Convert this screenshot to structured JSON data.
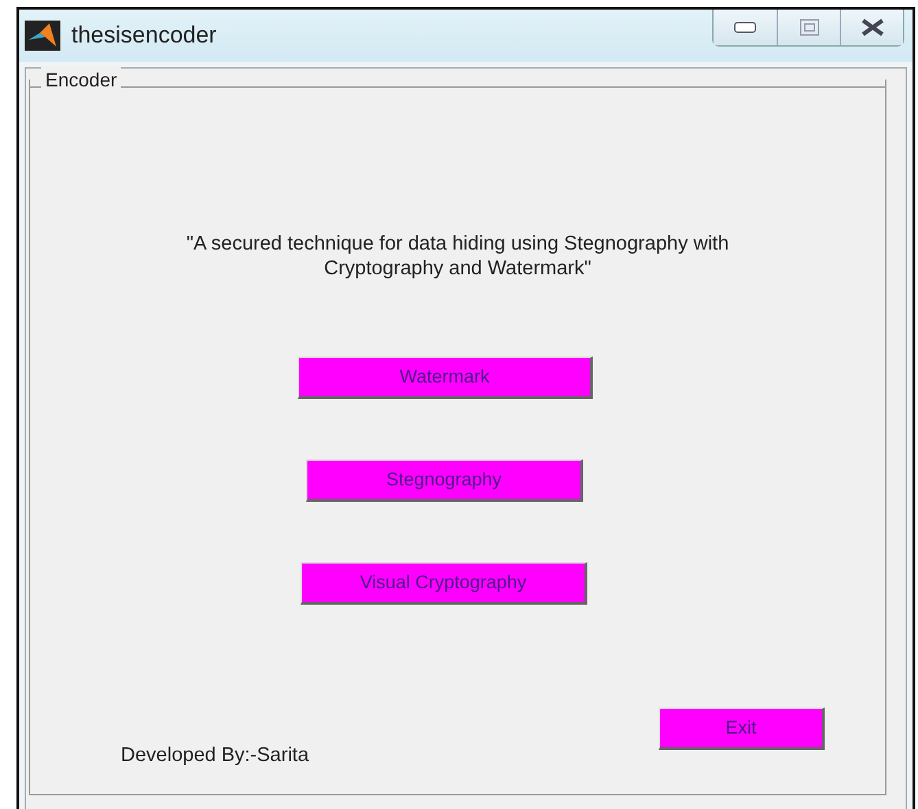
{
  "window": {
    "title": "thesisencoder"
  },
  "panel": {
    "title": "Encoder",
    "heading": "\"A secured technique for data hiding using Stegnography with Cryptography and Watermark\"",
    "buttons": [
      {
        "label": "Watermark"
      },
      {
        "label": "Stegnography"
      },
      {
        "label": "Visual Cryptography"
      }
    ],
    "credit": "Developed By:-Sarita",
    "exit_button": {
      "label": "Exit"
    }
  }
}
